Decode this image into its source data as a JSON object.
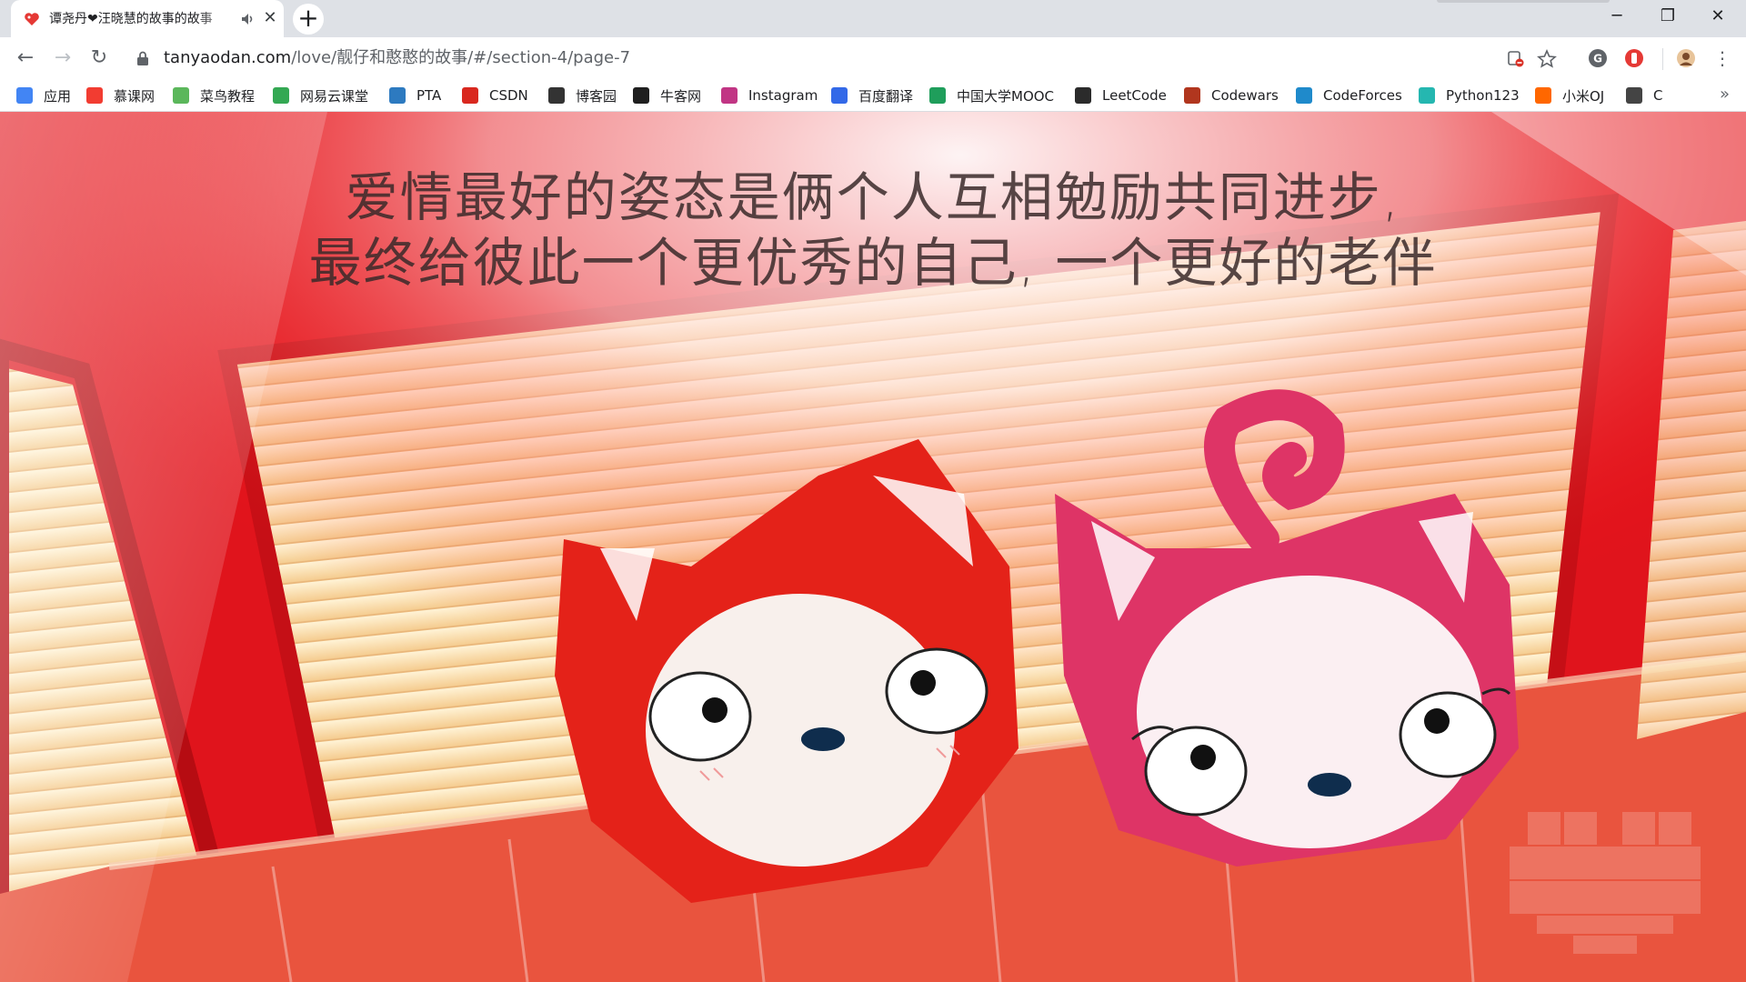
{
  "browser": {
    "tab_title": "谭尧丹❤汪晓慧的故事的故事",
    "new_tab_label": "+",
    "window_controls": {
      "minimize": "─",
      "restore": "❐",
      "close": "✕"
    },
    "url_host": "tanyaodan.com",
    "url_path": "/love/靓仔和憨憨的故事/#/section-4/page-7"
  },
  "bookmarks": [
    {
      "label": "应用",
      "icon": "apps-grid-icon",
      "color": "#4285f4"
    },
    {
      "label": "慕课网",
      "icon": "imooc-flame-icon",
      "color": "#f23c31"
    },
    {
      "label": "菜鸟教程",
      "icon": "runoob-icon",
      "color": "#5bb75b"
    },
    {
      "label": "网易云课堂",
      "icon": "netease-study-icon",
      "color": "#34a853"
    },
    {
      "label": "PTA",
      "icon": "pta-icon",
      "color": "#2d7ac0"
    },
    {
      "label": "CSDN",
      "icon": "csdn-icon",
      "color": "#d9281f"
    },
    {
      "label": "博客园",
      "icon": "cnblogs-icon",
      "color": "#333333"
    },
    {
      "label": "牛客网",
      "icon": "nowcoder-icon",
      "color": "#1f1f1f"
    },
    {
      "label": "Instagram",
      "icon": "instagram-icon",
      "color": "#c13584"
    },
    {
      "label": "百度翻译",
      "icon": "baidu-translate-icon",
      "color": "#3369e8"
    },
    {
      "label": "中国大学MOOC",
      "icon": "mooc-flag-icon",
      "color": "#1f9e5b"
    },
    {
      "label": "LeetCode",
      "icon": "leetcode-icon",
      "color": "#2b2b2b"
    },
    {
      "label": "Codewars",
      "icon": "codewars-icon",
      "color": "#b1361e"
    },
    {
      "label": "CodeForces",
      "icon": "codeforces-icon",
      "color": "#1f8acb"
    },
    {
      "label": "Python123",
      "icon": "python123-icon",
      "color": "#25b7b0"
    },
    {
      "label": "小米OJ",
      "icon": "mi-icon",
      "color": "#ff6700"
    },
    {
      "label": "C",
      "icon": "c-lang-icon",
      "color": "#444444"
    }
  ],
  "bookmarks_more": "»",
  "page": {
    "quote_line1": "爱情最好的姿态是俩个人互相勉励共同进步,",
    "quote_line2": "最终给彼此一个更优秀的自己, 一个更好的老伴"
  },
  "colors": {
    "background_red": "#e0141c",
    "banner_cream": "#f7e2b4",
    "red_fox": "#e42219",
    "pink_fox": "#de3466"
  }
}
